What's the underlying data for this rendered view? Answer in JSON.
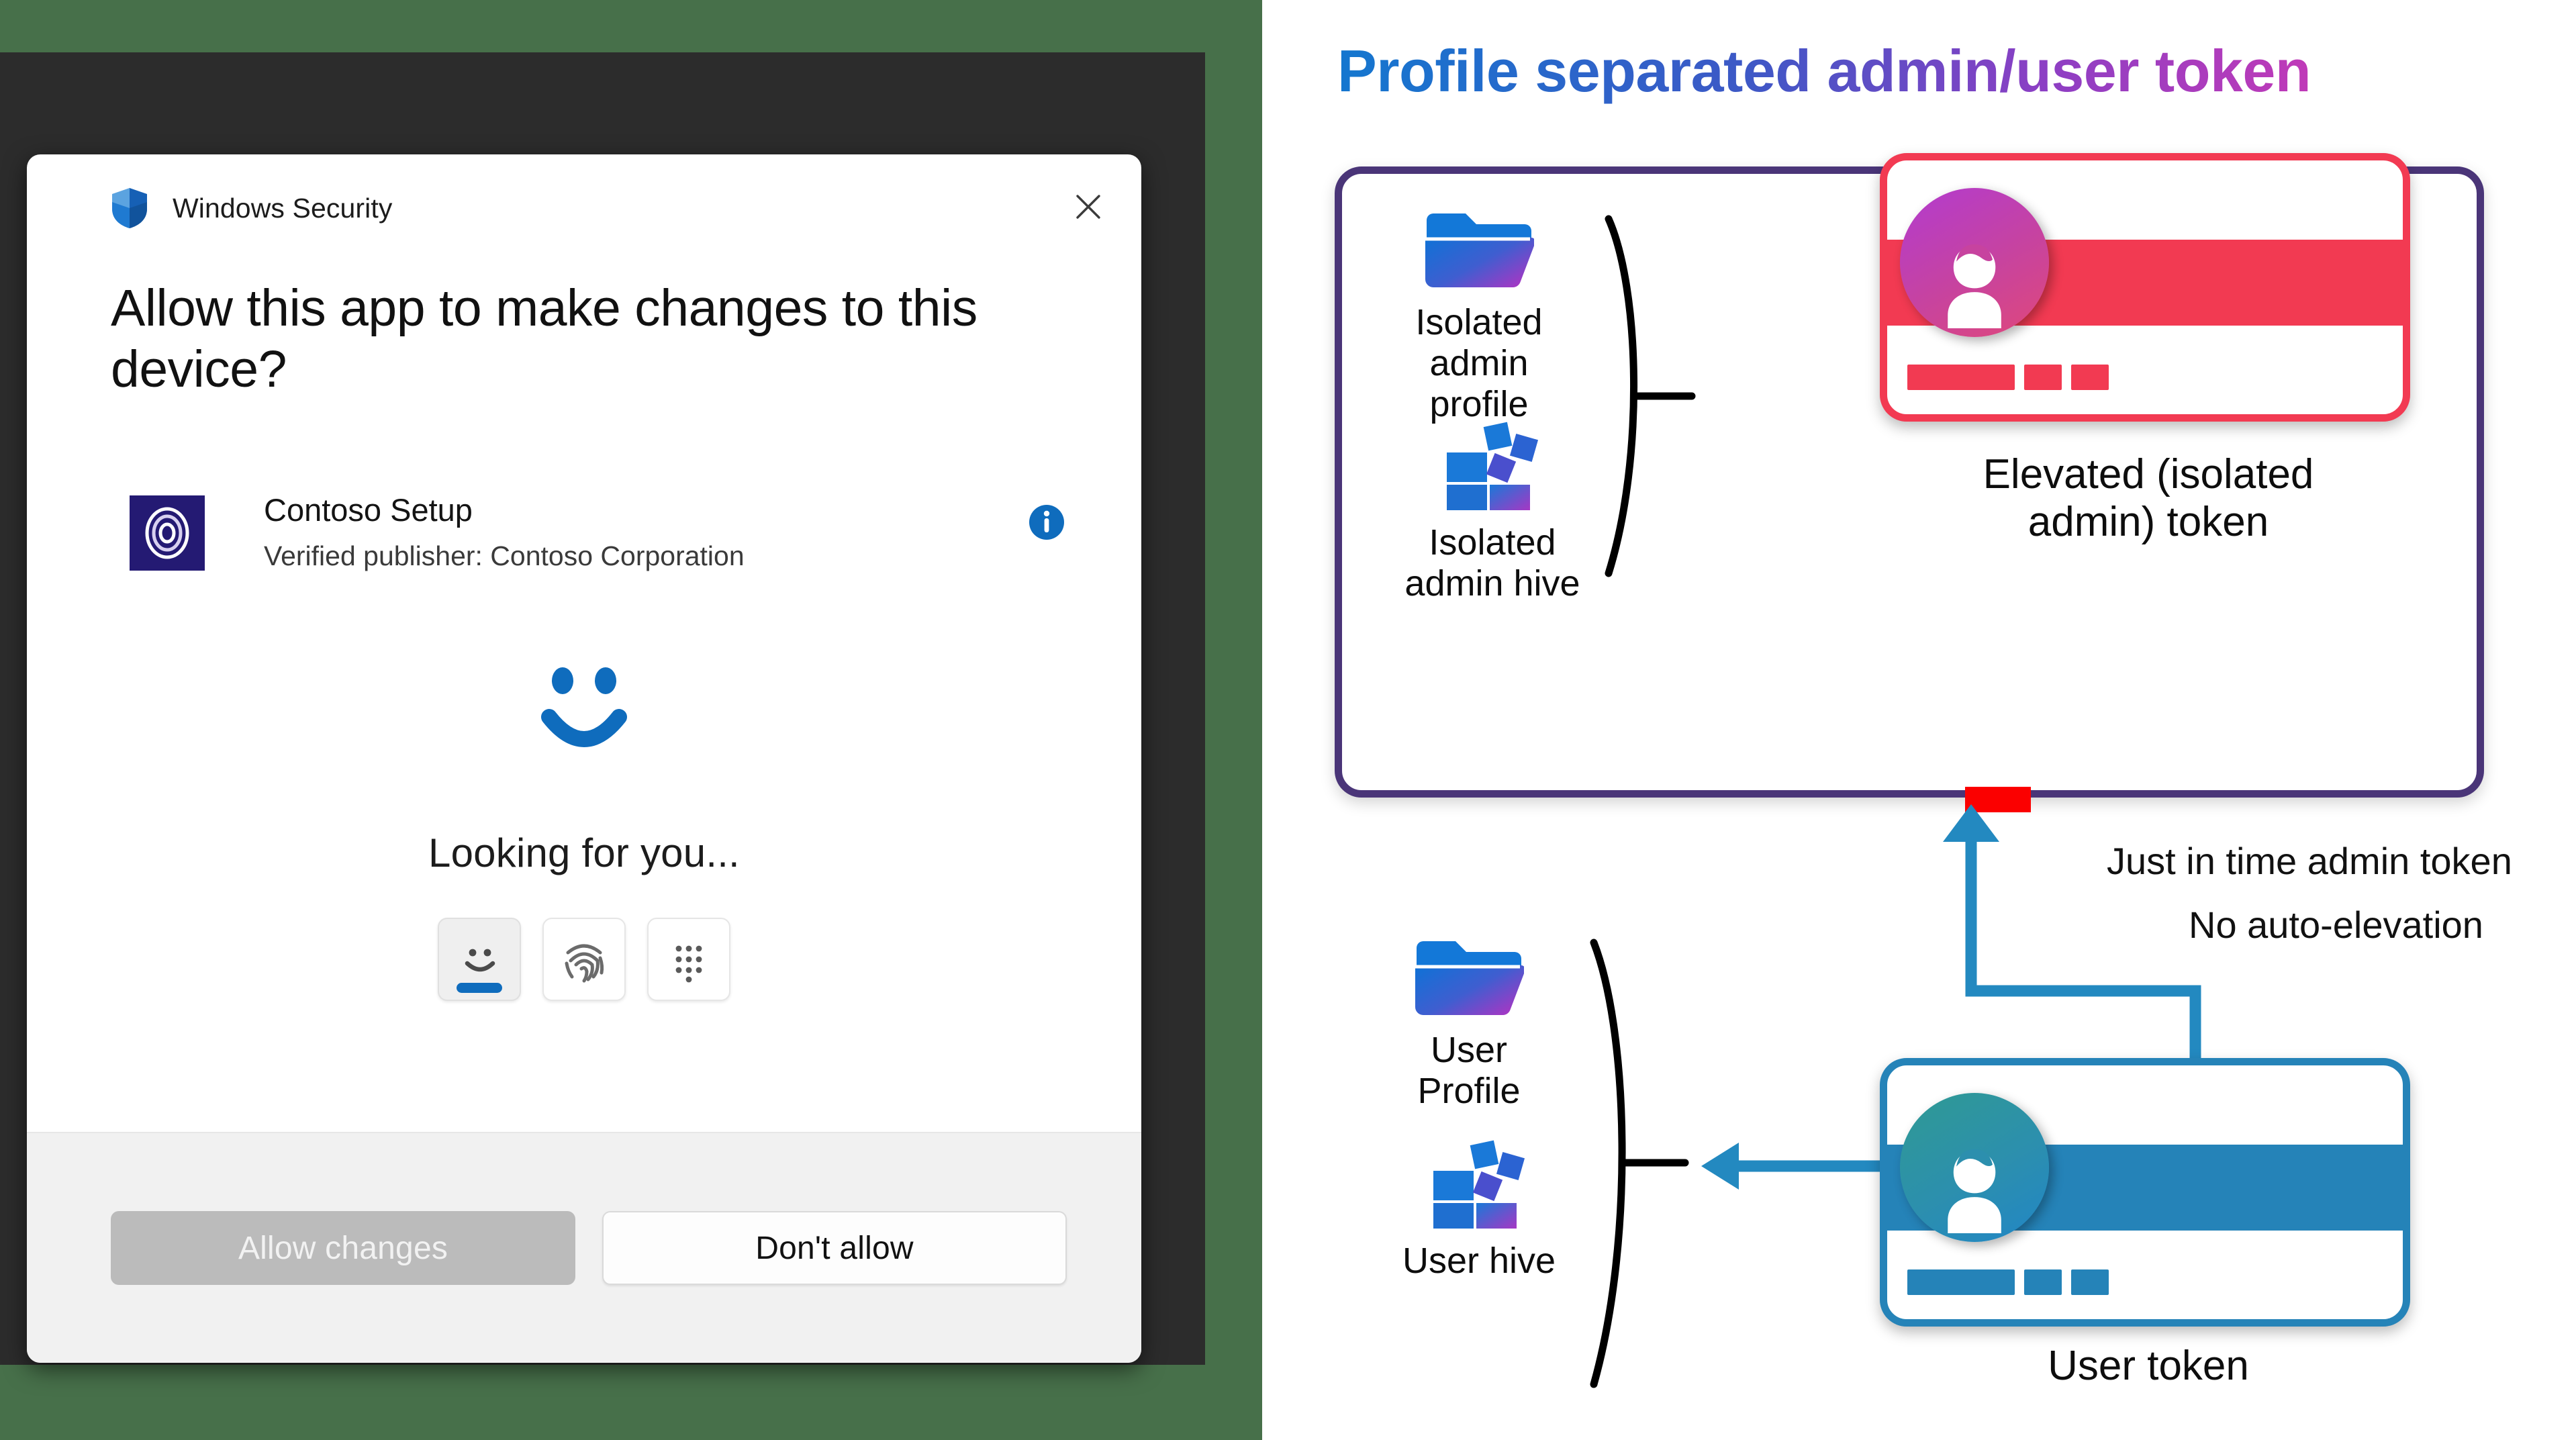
{
  "colors": {
    "desktop_background": "#47704a",
    "window_frame": "#2c2c2c",
    "accent_blue": "#0f6cbd",
    "admin_box_border": "#4a3578",
    "admin_token_red": "#f23a52",
    "user_token_blue": "#2583b8",
    "arrow_blue": "#2389c0",
    "red_tab": "#fb0000",
    "title_gradient_from": "#1477cf",
    "title_gradient_to": "#c03ab8"
  },
  "uac_dialog": {
    "titlebar": {
      "icon": "shield-icon",
      "title": "Windows Security",
      "close_label": "close-icon"
    },
    "heading": "Allow this app to make changes to this device?",
    "app": {
      "icon": "contoso-app-icon",
      "name": "Contoso Setup",
      "publisher": "Verified publisher: Contoso Corporation",
      "info_icon": "info-icon"
    },
    "hello": {
      "face_icon": "smiley-face-icon",
      "status": "Looking for you...",
      "methods": [
        {
          "icon": "face-icon",
          "name": "face-recognition",
          "selected": true
        },
        {
          "icon": "fingerprint-icon",
          "name": "fingerprint",
          "selected": false
        },
        {
          "icon": "pin-keypad-icon",
          "name": "pin",
          "selected": false
        }
      ]
    },
    "buttons": {
      "allow": "Allow changes",
      "deny": "Don't allow"
    }
  },
  "diagram": {
    "title": "Profile separated admin/user token",
    "admin_box": {
      "items": [
        {
          "icon": "folder-icon",
          "label": "Isolated\nadmin\nprofile"
        },
        {
          "icon": "registry-hive-icon",
          "label": "Isolated\nadmin hive"
        }
      ],
      "token_caption": "Elevated (isolated\nadmin) token",
      "token_color": "#f23a52"
    },
    "user_area": {
      "items": [
        {
          "icon": "folder-icon",
          "label": "User\nProfile"
        },
        {
          "icon": "registry-hive-icon",
          "label": "User hive"
        }
      ],
      "token_caption": "User token",
      "token_color": "#2583b8"
    },
    "annotations": [
      {
        "text": "Just in time admin token",
        "name": "jit-admin-token-annotation"
      },
      {
        "text": "No auto-elevation",
        "name": "no-auto-elevation-annotation"
      }
    ]
  }
}
